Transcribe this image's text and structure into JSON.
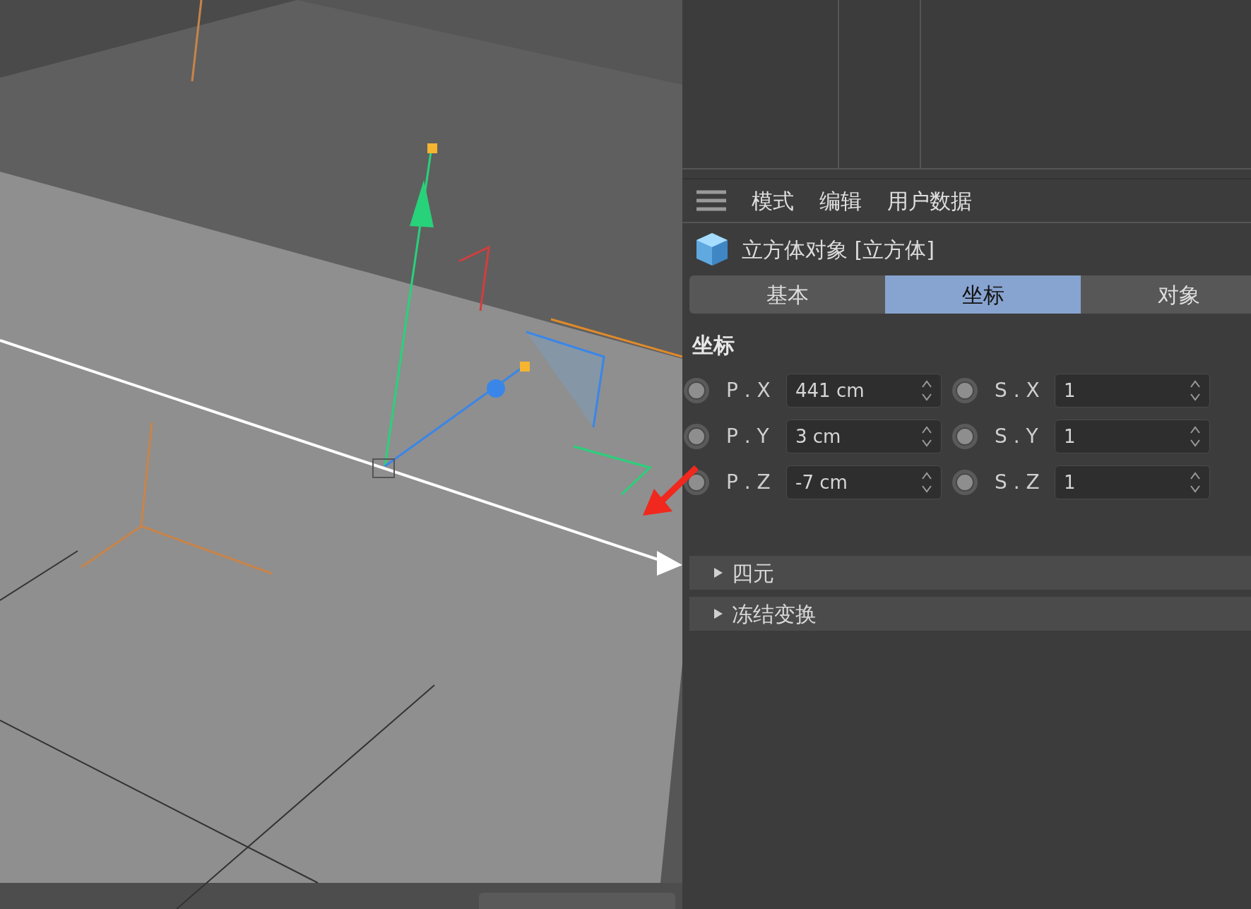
{
  "menu": [
    "模式",
    "编辑",
    "用户数据"
  ],
  "object_title": "立方体对象 [立方体]",
  "tabs": [
    {
      "label": "基本",
      "selected": false
    },
    {
      "label": "坐标",
      "selected": true
    },
    {
      "label": "对象",
      "selected": false
    }
  ],
  "section_title": "坐标",
  "rows": [
    {
      "p_label": "P . X",
      "p_value": "441 cm",
      "s_label": "S . X",
      "s_value": "1"
    },
    {
      "p_label": "P . Y",
      "p_value": "3 cm",
      "s_label": "S . Y",
      "s_value": "1"
    },
    {
      "p_label": "P . Z",
      "p_value": "-7 cm",
      "s_label": "S . Z",
      "s_value": "1"
    }
  ],
  "groups": [
    {
      "label": "四元",
      "expanded": false
    },
    {
      "label": "冻结变换",
      "expanded": false
    }
  ]
}
